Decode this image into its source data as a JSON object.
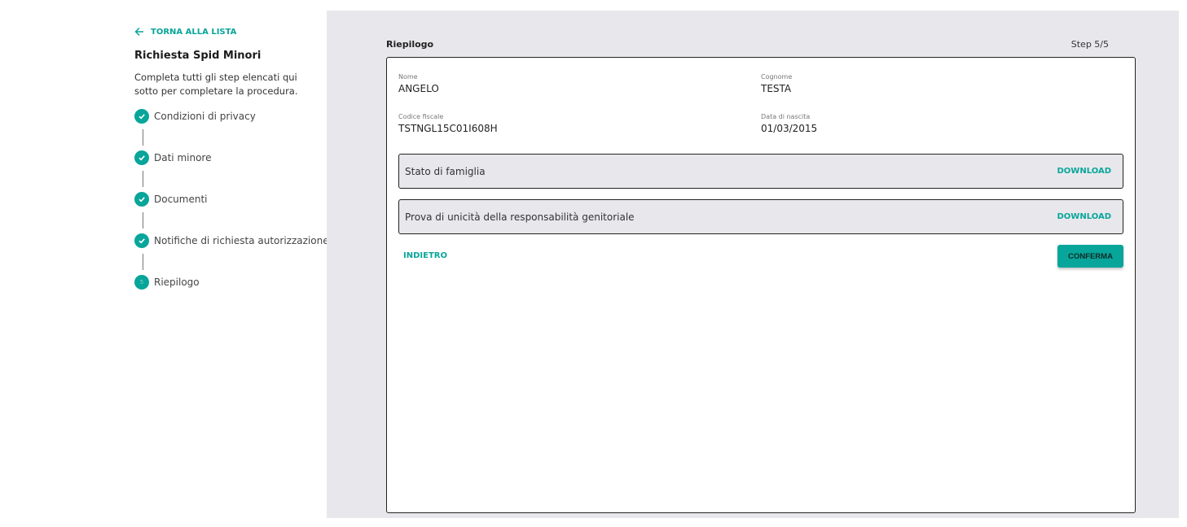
{
  "sidebar": {
    "back_label": "TORNA ALLA LISTA",
    "title": "Richiesta Spid Minori",
    "description": "Completa tutti gli step elencati qui sotto per completare la procedura.",
    "steps": [
      {
        "label": "Condizioni di privacy",
        "status": "done"
      },
      {
        "label": "Dati minore",
        "status": "done"
      },
      {
        "label": "Documenti",
        "status": "done"
      },
      {
        "label": "Notifiche di richiesta autorizzazione",
        "status": "done"
      },
      {
        "label": "Riepilogo",
        "status": "current",
        "number": "5"
      }
    ]
  },
  "main": {
    "title": "Riepilogo",
    "step_indicator": "Step 5/5",
    "fields": {
      "nome": {
        "label": "Nome",
        "value": "ANGELO"
      },
      "cognome": {
        "label": "Cognome",
        "value": "TESTA"
      },
      "codice_fiscale": {
        "label": "Codice fiscale",
        "value": "TSTNGL15C01I608H"
      },
      "data_nascita": {
        "label": "Data di nascita",
        "value": "01/03/2015"
      }
    },
    "documents": [
      {
        "name": "Stato di famiglia",
        "action": "DOWNLOAD"
      },
      {
        "name": "Prova di unicità della responsabilità genitoriale",
        "action": "DOWNLOAD"
      }
    ],
    "back_button": "INDIETRO",
    "confirm_button": "CONFERMA"
  },
  "colors": {
    "accent": "#08a59a",
    "panel_background": "#e8e8ec"
  }
}
